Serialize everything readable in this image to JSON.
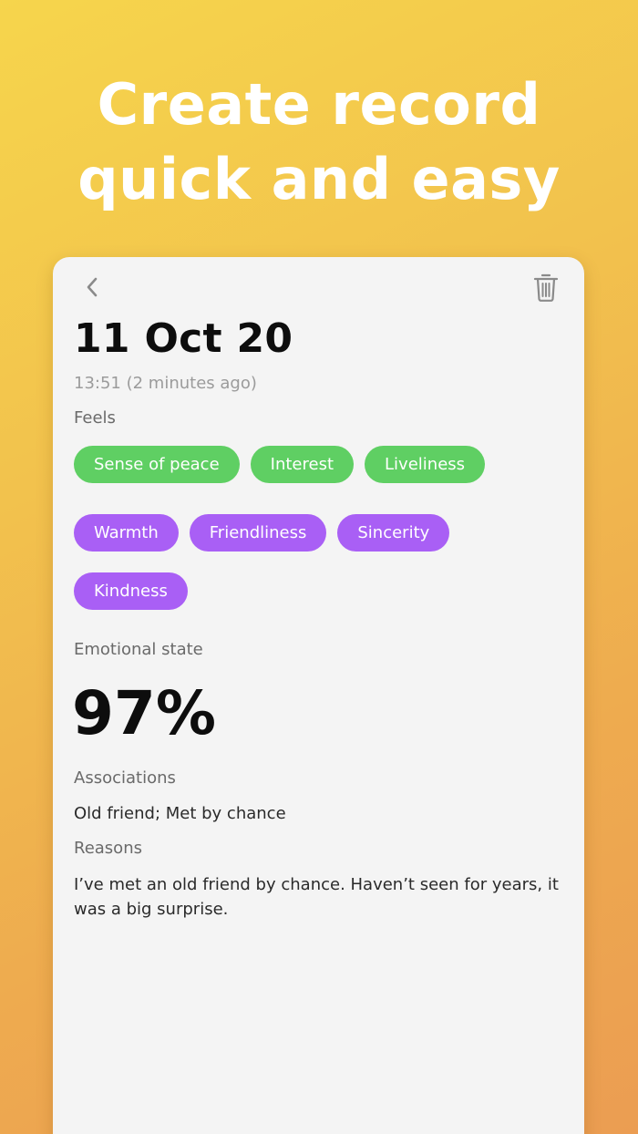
{
  "headline": {
    "line1": "Create record",
    "line2": "quick and easy"
  },
  "record": {
    "date": "11 Oct 20",
    "time": "13:51 (2 minutes ago)",
    "feels_label": "Feels",
    "feels_green": [
      "Sense of peace",
      "Interest",
      "Liveliness"
    ],
    "feels_purple_row1": [
      "Warmth",
      "Friendliness",
      "Sincerity"
    ],
    "feels_purple_row2": [
      "Kindness"
    ],
    "emotional_state_label": "Emotional state",
    "emotional_state_value": "97%",
    "associations_label": "Associations",
    "associations_value": "Old friend; Met by chance",
    "reasons_label": "Reasons",
    "reasons_value": "I’ve met an old friend by chance. Haven’t seen for years, it was a big surprise."
  },
  "icons": {
    "back": "chevron-left-icon",
    "delete": "trash-icon"
  },
  "colors": {
    "green_chip": "#5fcf63",
    "purple_chip": "#a95ff5",
    "card_bg": "#f4f4f4"
  }
}
